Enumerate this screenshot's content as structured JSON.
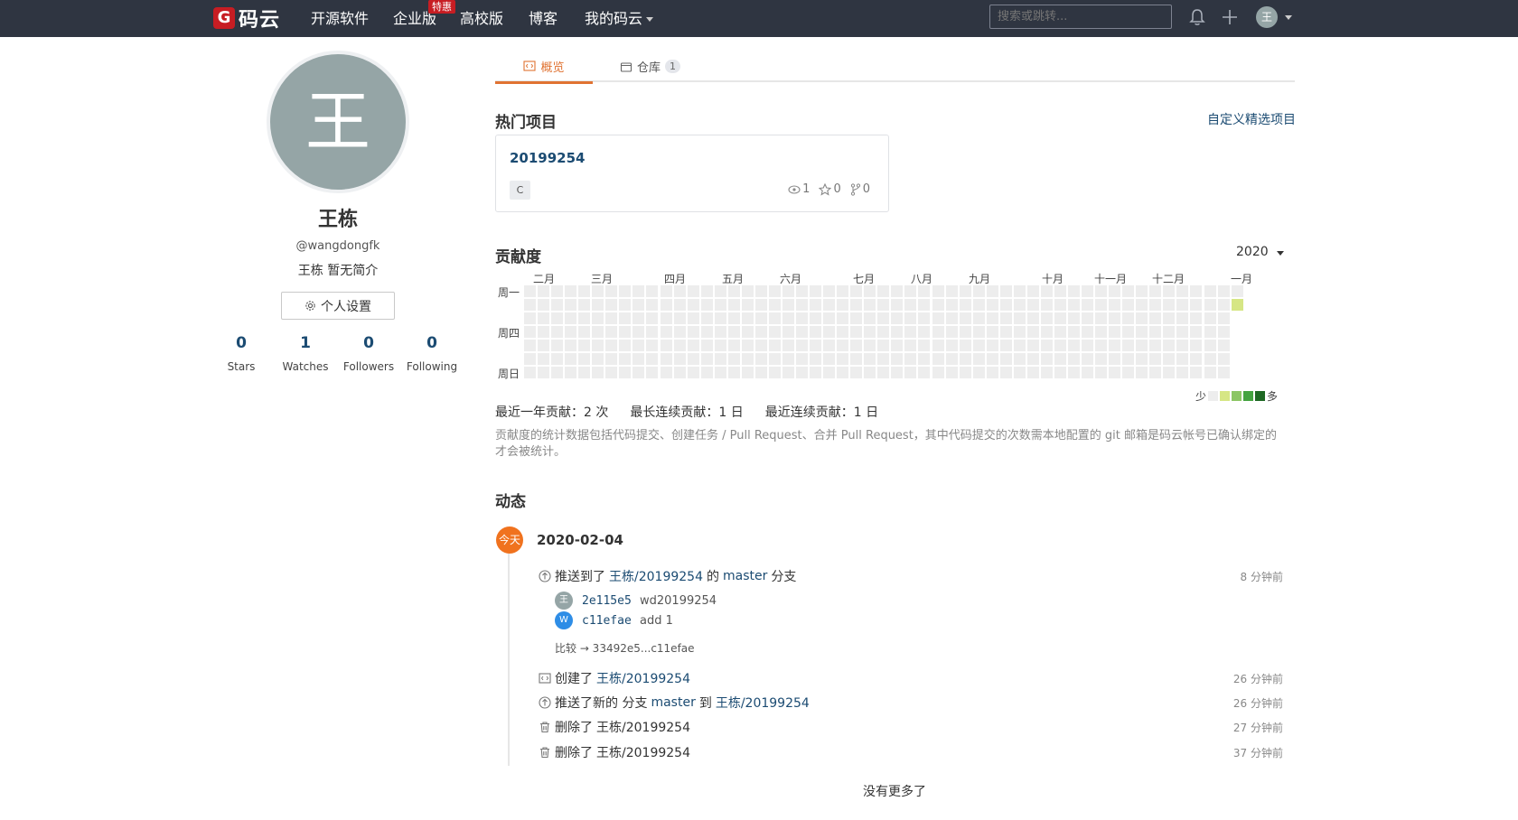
{
  "topnav": {
    "logo_mark": "G",
    "logo_text": "码云",
    "items": [
      "开源软件",
      "企业版",
      "高校版",
      "博客",
      "我的码云"
    ],
    "hot_badge": "特惠",
    "search_placeholder": "搜索或跳转...",
    "avatar_initial": "王"
  },
  "profile": {
    "avatar_initial": "王",
    "name": "王栋",
    "handle": "@wangdongfk",
    "bio": "王栋 暂无简介",
    "settings_label": "个人设置",
    "stats": [
      {
        "value": "0",
        "label": "Stars"
      },
      {
        "value": "1",
        "label": "Watches"
      },
      {
        "value": "0",
        "label": "Followers"
      },
      {
        "value": "0",
        "label": "Following"
      }
    ]
  },
  "tabs": [
    {
      "label": "概览"
    },
    {
      "label": "仓库",
      "count": "1"
    }
  ],
  "popular": {
    "title": "热门项目",
    "customize_link": "自定义精选项目",
    "project": {
      "name": "20199254",
      "language": "C",
      "watches": "1",
      "stars": "0",
      "forks": "0"
    }
  },
  "contribution": {
    "title": "贡献度",
    "year": "2020",
    "months": [
      "二月",
      "三月",
      "四月",
      "五月",
      "六月",
      "七月",
      "八月",
      "九月",
      "十月",
      "十一月",
      "十二月",
      "一月"
    ],
    "day_labels": [
      "周一",
      "周四",
      "周日"
    ],
    "legend_less": "少",
    "legend_more": "多",
    "legend_colors": [
      "#ededed",
      "#d6e685",
      "#8cc665",
      "#44a340",
      "#1e6823"
    ],
    "active_cell_color": "#d6e685",
    "summary": {
      "last_year": "最近一年贡献：2 次",
      "longest": "最长连续贡献：1 日",
      "recent": "最近连续贡献：1 日"
    },
    "note": "贡献度的统计数据包括代码提交、创建任务 / Pull Request、合并 Pull Request，其中代码提交的次数需本地配置的 git 邮箱是码云帐号已确认绑定的才会被统计。"
  },
  "feed": {
    "title": "动态",
    "today_label": "今天",
    "date": "2020-02-04",
    "push_event": {
      "prefix": "推送到了",
      "repo": "王栋/20199254",
      "mid": "的",
      "branch": "master",
      "suffix": "分支",
      "time": "8 分钟前",
      "commits": [
        {
          "avatar": "王",
          "avatar_color": "#95a5a6",
          "hash": "2e115e5",
          "message": "wd20199254"
        },
        {
          "avatar": "W",
          "avatar_color": "#2e8de6",
          "hash": "c11efae",
          "message": "add 1"
        }
      ],
      "compare": "比较 → 33492e5...c11efae"
    },
    "events": [
      {
        "icon": "code-icon",
        "prefix": "创建了",
        "repo": "王栋/20199254",
        "time": "26 分钟前"
      },
      {
        "icon": "push-icon",
        "prefix": "推送了新的 分支",
        "branch": "master",
        "mid": "到",
        "repo": "王栋/20199254",
        "time": "26 分钟前"
      },
      {
        "icon": "trash-icon",
        "prefix": "删除了",
        "repo": "王栋/20199254",
        "time": "27 分钟前"
      },
      {
        "icon": "trash-icon",
        "prefix": "删除了",
        "repo": "王栋/20199254",
        "time": "37 分钟前"
      }
    ],
    "no_more": "没有更多了"
  }
}
